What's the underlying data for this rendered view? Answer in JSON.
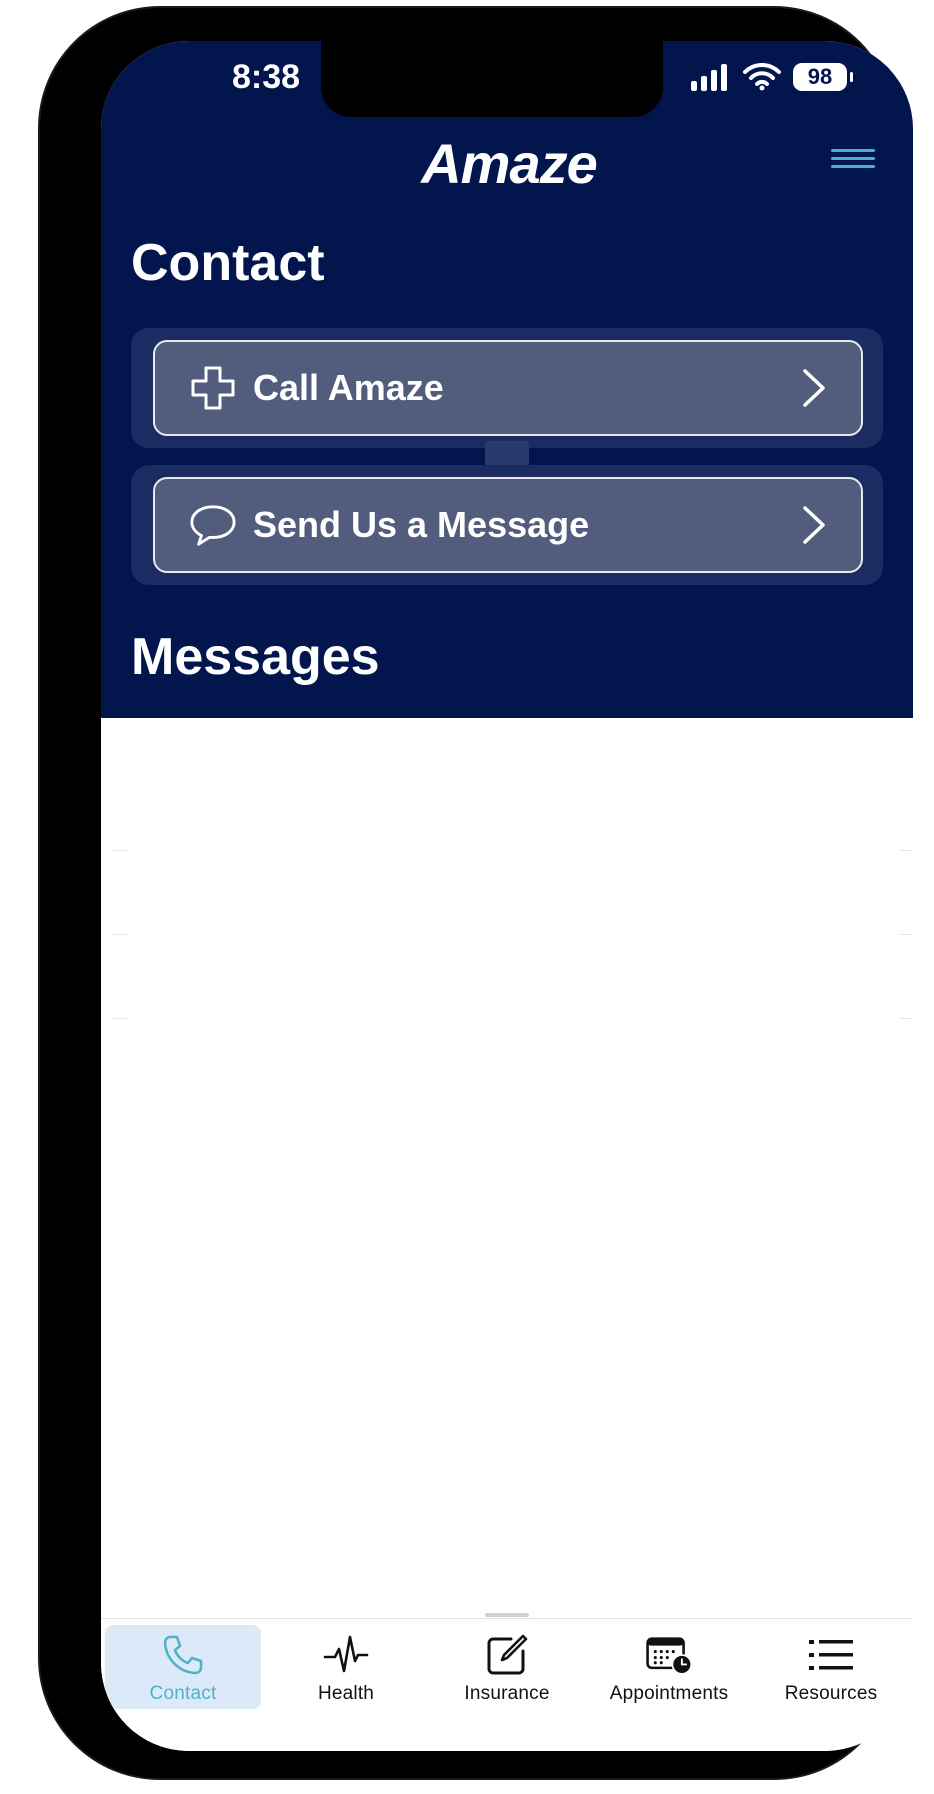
{
  "status_bar": {
    "time": "8:38",
    "battery": "98"
  },
  "header": {
    "logo_text": "Amaze"
  },
  "contact": {
    "title": "Contact",
    "call_label": "Call Amaze",
    "message_label": "Send Us a Message"
  },
  "messages": {
    "title": "Messages"
  },
  "tabs": [
    {
      "label": "Contact",
      "icon": "phone-icon",
      "active": true
    },
    {
      "label": "Health",
      "icon": "heartbeat-icon",
      "active": false
    },
    {
      "label": "Insurance",
      "icon": "edit-icon",
      "active": false
    },
    {
      "label": "Appointments",
      "icon": "calendar-clock-icon",
      "active": false
    },
    {
      "label": "Resources",
      "icon": "list-icon",
      "active": false
    }
  ],
  "colors": {
    "header_bg": "#03154d",
    "accent": "#4fb3c8",
    "card_bg": "#525d7e",
    "active_tab_bg": "#dbe9f9"
  }
}
